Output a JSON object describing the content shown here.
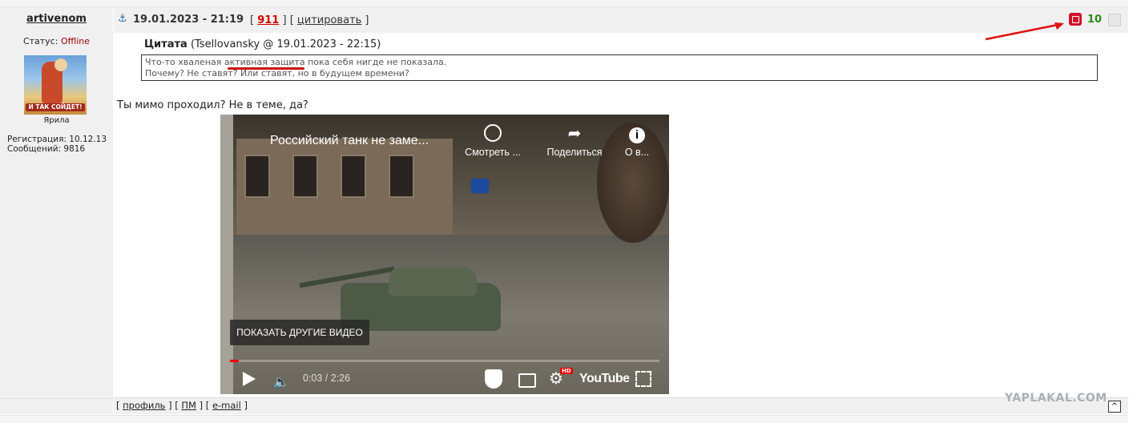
{
  "post": {
    "author": "artivenom",
    "status_label": "Статус:",
    "status_value": "Offline",
    "avatar_caption": "И ТАК СОЙДЕТ!",
    "avatar_name": "Ярила",
    "registration": "Регистрация: 10.12.13",
    "messages": "Сообщений: 9816",
    "date": "19.01.2023 - 21:19",
    "post_number": "911",
    "quote_button": "цитировать",
    "rating": "10",
    "quote_title": "Цитата",
    "quote_source": "(Tsellovansky @ 19.01.2023 - 22:15)",
    "quote_line1": "Что-то хваленая активная защита пока себя нигде не показала.",
    "quote_line2": "Почему? Не ставят? Или ставят, но в будущем времени?",
    "reply_text": "Ты мимо проходил? Не в теме, да?"
  },
  "video": {
    "title": "Российский танк не заме...",
    "watch_later": "Смотреть ...",
    "share": "Поделиться",
    "about": "О в...",
    "more_videos": "ПОКАЗАТЬ ДРУГИЕ ВИДЕО",
    "time": "0:03 / 2:26",
    "hd_badge": "HD",
    "brand": "YouTube",
    "progress": 0.02
  },
  "footer": {
    "profile": "профиль",
    "pm": "ПМ",
    "email": "e-mail",
    "watermark": "YAPLAKAL.COM",
    "to_top": "^"
  },
  "colors": {
    "rating_green": "#2a8a1a",
    "post_number_red": "#cc0000",
    "status_offline": "#990000",
    "arrow_red": "#dd1111"
  }
}
